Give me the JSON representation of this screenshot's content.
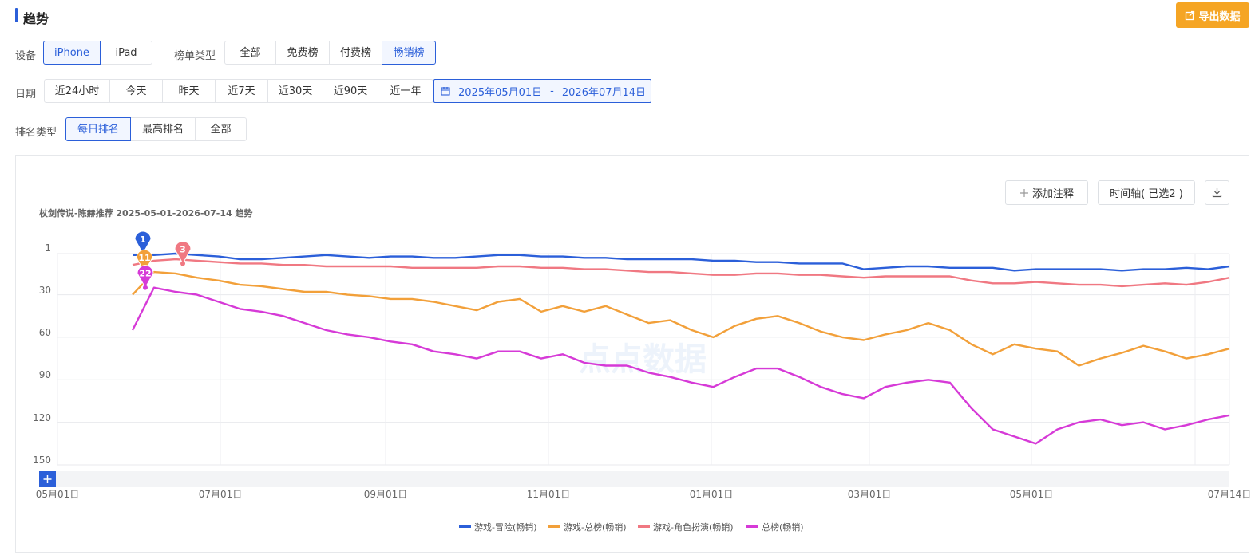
{
  "header": {
    "title": "趋势",
    "export_label": "导出数据"
  },
  "device": {
    "label": "设备",
    "options": [
      "iPhone",
      "iPad"
    ],
    "selected": "iPhone"
  },
  "list_type": {
    "label": "榜单类型",
    "options": [
      "全部",
      "免费榜",
      "付费榜",
      "畅销榜"
    ],
    "selected": "畅销榜"
  },
  "date": {
    "label": "日期",
    "options": [
      "近24小时",
      "今天",
      "昨天",
      "近7天",
      "近30天",
      "近90天",
      "近一年"
    ],
    "range_start": "2025年05月01日",
    "range_sep": "-",
    "range_end": "2026年07月14日"
  },
  "rank_type": {
    "label": "排名类型",
    "options": [
      "每日排名",
      "最高排名",
      "全部"
    ],
    "selected": "每日排名"
  },
  "toolbar": {
    "annotate_label": "添加注释",
    "timeline_label": "时间轴( 已选2 )"
  },
  "watermark": "点点数据",
  "chart_data": {
    "type": "line",
    "title": "杖剑传说-陈赫推荐 2025-05-01-2026-07-14 趋势",
    "y_ticks": [
      "1",
      "30",
      "60",
      "90",
      "120",
      "150"
    ],
    "ylim": [
      1,
      150
    ],
    "y_reversed": true,
    "x_ticks": [
      "05月01日",
      "07月01日",
      "09月01日",
      "11月01日",
      "01月01日",
      "03月01日",
      "05月01日",
      "07月14日"
    ],
    "x_range": [
      "2025-05-01",
      "2026-07-14"
    ],
    "grid": true,
    "legend_position": "bottom",
    "series": [
      {
        "name": "游戏-冒险(畅销)",
        "color": "#2b5fd9",
        "marker": "1",
        "values": [
          2,
          2,
          1,
          2,
          3,
          5,
          5,
          4,
          3,
          2,
          3,
          4,
          3,
          3,
          4,
          4,
          3,
          2,
          2,
          3,
          3,
          4,
          4,
          5,
          5,
          5,
          5,
          6,
          6,
          7,
          7,
          8,
          8,
          8,
          12,
          11,
          10,
          10,
          11,
          11,
          11,
          13,
          12,
          12,
          12,
          12,
          13,
          12,
          12,
          11,
          12,
          10
        ]
      },
      {
        "name": "游戏-总榜(畅销)",
        "color": "#f2a03a",
        "marker": "11",
        "values": [
          30,
          14,
          15,
          18,
          20,
          23,
          24,
          26,
          28,
          28,
          30,
          31,
          33,
          33,
          35,
          38,
          41,
          35,
          33,
          42,
          38,
          42,
          38,
          44,
          50,
          48,
          55,
          60,
          52,
          47,
          45,
          50,
          56,
          60,
          62,
          58,
          55,
          50,
          55,
          65,
          72,
          65,
          68,
          70,
          80,
          75,
          71,
          66,
          70,
          75,
          72,
          68
        ]
      },
      {
        "name": "游戏-角色扮演(畅销)",
        "color": "#f07882",
        "marker": "3",
        "values": [
          9,
          6,
          5,
          6,
          7,
          8,
          8,
          9,
          9,
          10,
          10,
          10,
          10,
          11,
          11,
          11,
          11,
          10,
          10,
          11,
          11,
          12,
          12,
          13,
          14,
          14,
          15,
          16,
          16,
          15,
          15,
          16,
          16,
          17,
          18,
          17,
          17,
          17,
          17,
          20,
          22,
          22,
          21,
          22,
          23,
          23,
          24,
          23,
          22,
          23,
          21,
          18
        ]
      },
      {
        "name": "总榜(畅销)",
        "color": "#d63ad7",
        "marker": "22",
        "values": [
          55,
          25,
          28,
          30,
          35,
          40,
          42,
          45,
          50,
          55,
          58,
          60,
          63,
          65,
          70,
          72,
          75,
          70,
          70,
          75,
          72,
          78,
          80,
          80,
          85,
          88,
          92,
          95,
          88,
          82,
          82,
          88,
          95,
          100,
          103,
          95,
          92,
          90,
          92,
          110,
          125,
          130,
          135,
          125,
          120,
          118,
          122,
          120,
          125,
          122,
          118,
          115
        ]
      }
    ]
  }
}
